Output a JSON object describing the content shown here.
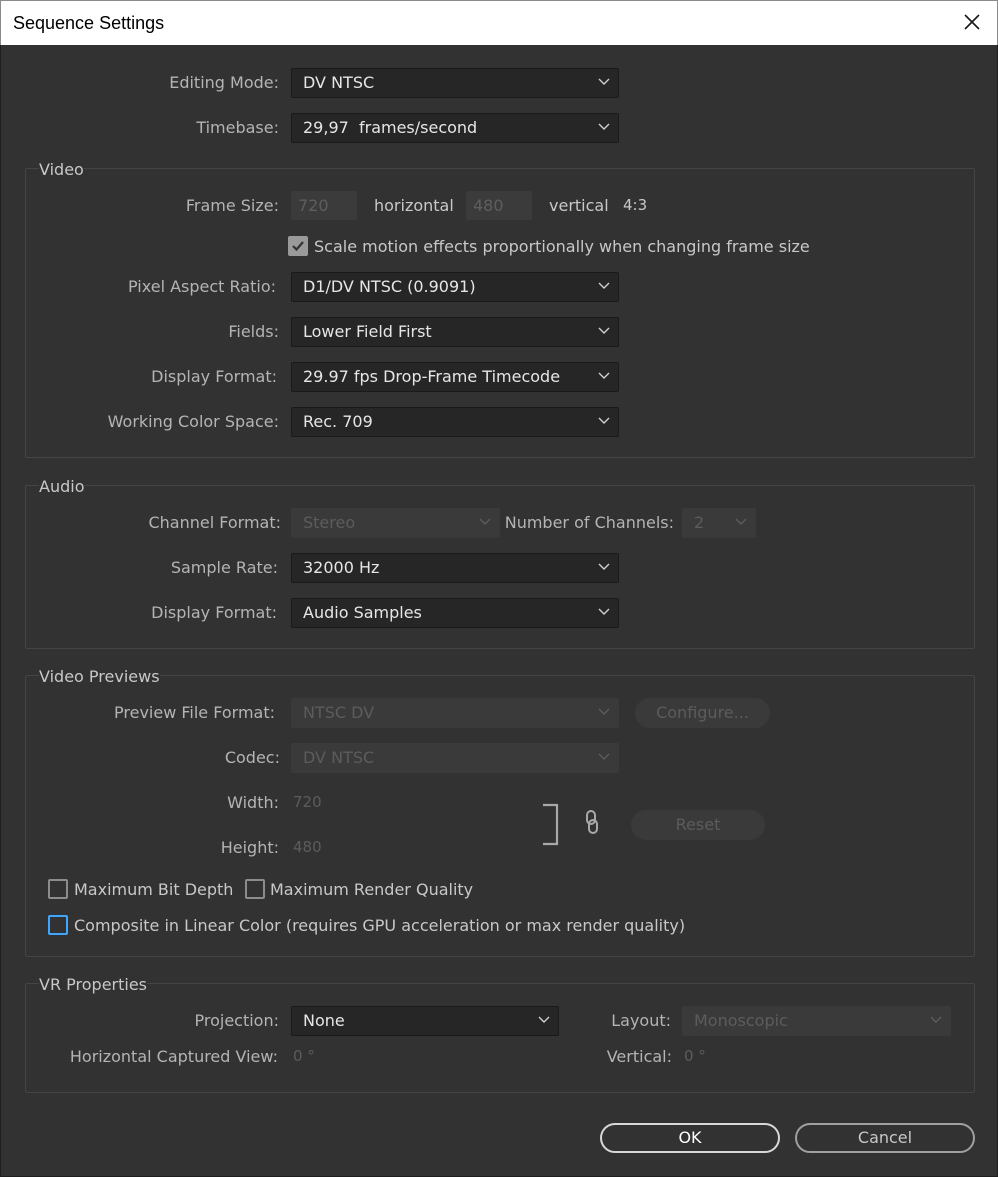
{
  "window": {
    "title": "Sequence Settings",
    "close_icon": "close-icon"
  },
  "general": {
    "editing_mode": {
      "label": "Editing Mode:",
      "value": "DV NTSC"
    },
    "timebase": {
      "label": "Timebase:",
      "value": "29,97  frames/second"
    }
  },
  "video": {
    "group_label": "Video",
    "frame_size": {
      "label": "Frame Size:",
      "width": "720",
      "horizontal_label": "horizontal",
      "height": "480",
      "vertical_label": "vertical",
      "aspect": "4:3"
    },
    "scale_motion": {
      "label": "Scale motion effects proportionally when changing frame size",
      "checked": true
    },
    "pixel_aspect_ratio": {
      "label": "Pixel Aspect Ratio:",
      "value": "D1/DV NTSC (0.9091)"
    },
    "fields": {
      "label": "Fields:",
      "value": "Lower Field First"
    },
    "display_format": {
      "label": "Display Format:",
      "value": "29.97 fps Drop-Frame Timecode"
    },
    "working_color_space": {
      "label": "Working Color Space:",
      "value": "Rec. 709"
    }
  },
  "audio": {
    "group_label": "Audio",
    "channel_format": {
      "label": "Channel Format:",
      "value": "Stereo"
    },
    "number_of_channels": {
      "label": "Number of Channels:",
      "value": "2"
    },
    "sample_rate": {
      "label": "Sample Rate:",
      "value": "32000 Hz"
    },
    "display_format": {
      "label": "Display Format:",
      "value": "Audio Samples"
    }
  },
  "video_previews": {
    "group_label": "Video Previews",
    "preview_file_format": {
      "label": "Preview File Format:",
      "value": "NTSC DV"
    },
    "configure_button": "Configure...",
    "codec": {
      "label": "Codec:",
      "value": "DV NTSC"
    },
    "width": {
      "label": "Width:",
      "value": "720"
    },
    "height": {
      "label": "Height:",
      "value": "480"
    },
    "reset_button": "Reset",
    "max_bit_depth": {
      "label": "Maximum Bit Depth",
      "checked": false
    },
    "max_render_quality": {
      "label": "Maximum Render Quality",
      "checked": false
    },
    "composite_linear": {
      "label": "Composite in Linear Color (requires GPU acceleration or max render quality)",
      "checked": false
    }
  },
  "vr_properties": {
    "group_label": "VR Properties",
    "projection": {
      "label": "Projection:",
      "value": "None"
    },
    "layout": {
      "label": "Layout:",
      "value": "Monoscopic"
    },
    "horizontal_captured_view": {
      "label": "Horizontal Captured View:",
      "value": "0 °"
    },
    "vertical": {
      "label": "Vertical:",
      "value": "0 °"
    }
  },
  "footer": {
    "ok_button": "OK",
    "cancel_button": "Cancel"
  },
  "colors": {
    "background": "#323232",
    "accent_focus": "#3ea6ff",
    "dropdown_bg": "#262626"
  }
}
